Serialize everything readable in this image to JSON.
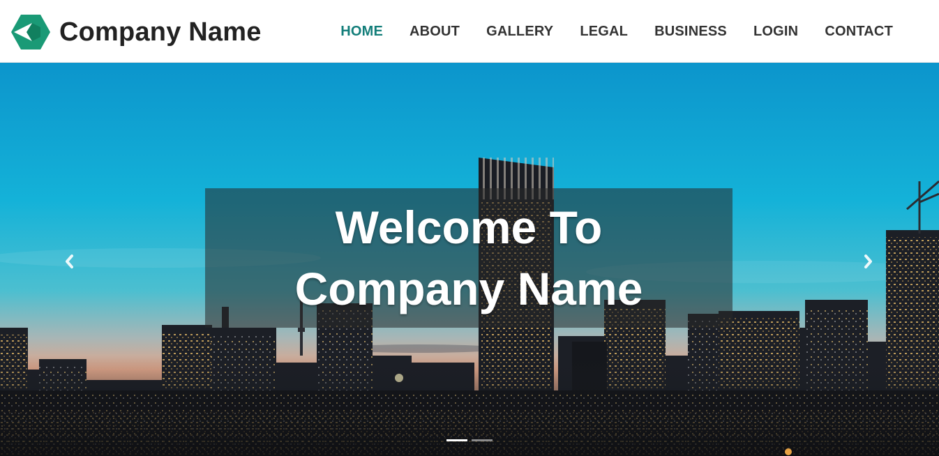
{
  "brand": {
    "name": "Company Name",
    "logo_icon": "hexagon-cube-logo",
    "logo_colors": [
      "#1a9a76",
      "#11805f",
      "#ffffff"
    ]
  },
  "nav": {
    "items": [
      {
        "label": "HOME",
        "active": true
      },
      {
        "label": "ABOUT",
        "active": false
      },
      {
        "label": "GALLERY",
        "active": false
      },
      {
        "label": "LEGAL",
        "active": false
      },
      {
        "label": "BUSINESS",
        "active": false
      },
      {
        "label": "LOGIN",
        "active": false
      },
      {
        "label": "CONTACT",
        "active": false
      }
    ],
    "active_color": "#137e7a",
    "text_color": "#333333"
  },
  "hero": {
    "caption_line1": "Welcome To",
    "caption_line2": "Company Name",
    "background": "city-skyline-at-dusk",
    "prev_icon": "chevron-left-icon",
    "next_icon": "chevron-right-icon",
    "slide_count": 2,
    "active_slide": 1
  }
}
